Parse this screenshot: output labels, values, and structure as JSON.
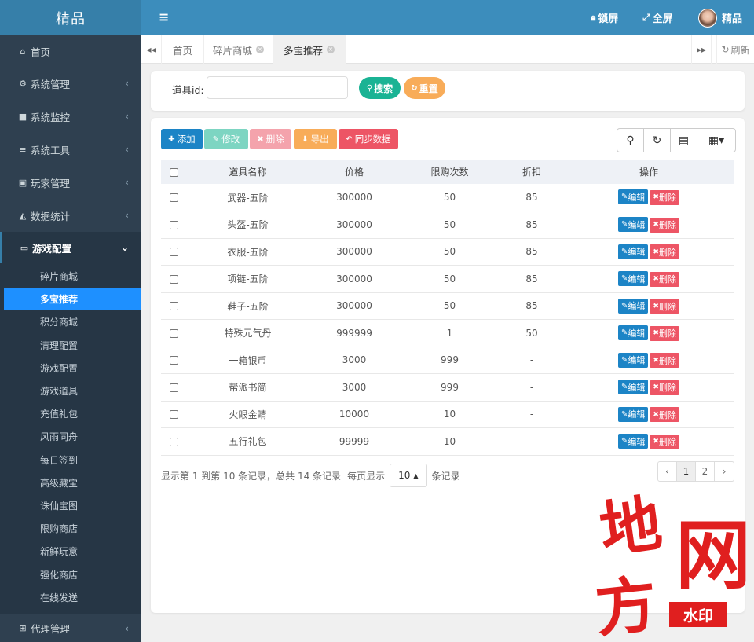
{
  "brand": "精品",
  "sidebar": {
    "items": [
      {
        "label": "首页",
        "icon": "home-icon"
      },
      {
        "label": "系统管理",
        "icon": "gear-icon"
      },
      {
        "label": "系统监控",
        "icon": "video-icon"
      },
      {
        "label": "系统工具",
        "icon": "bars-icon"
      },
      {
        "label": "玩家管理",
        "icon": "user-card-icon"
      },
      {
        "label": "数据统计",
        "icon": "area-chart-icon"
      },
      {
        "label": "游戏配置",
        "icon": "desktop-icon"
      }
    ],
    "submenu": [
      "碎片商城",
      "多宝推荐",
      "积分商城",
      "清理配置",
      "游戏配置",
      "游戏道具",
      "充值礼包",
      "风雨同舟",
      "每日签到",
      "高级藏宝",
      "诛仙宝图",
      "限购商店",
      "新鲜玩意",
      "强化商店",
      "在线发送"
    ],
    "active_sub": "多宝推荐",
    "bottom": {
      "label": "代理管理",
      "icon": "sitemap-icon"
    }
  },
  "topbar": {
    "lock": "锁屏",
    "fullscreen": "全屏",
    "user": "精品"
  },
  "tabs": {
    "items": [
      "首页",
      "碎片商城",
      "多宝推荐"
    ],
    "refresh": "刷新"
  },
  "search": {
    "label": "道具id:",
    "value": "",
    "search_btn": "搜索",
    "reset_btn": "重置"
  },
  "toolbar": {
    "add": "添加",
    "edit": "修改",
    "delete": "删除",
    "export": "导出",
    "sync": "同步数据"
  },
  "table": {
    "headers": [
      "道具名称",
      "价格",
      "限购次数",
      "折扣",
      "操作"
    ],
    "edit_label": "编辑",
    "delete_label": "删除",
    "rows": [
      {
        "name": "武器-五阶",
        "price": "300000",
        "limit": "50",
        "discount": "85"
      },
      {
        "name": "头盔-五阶",
        "price": "300000",
        "limit": "50",
        "discount": "85"
      },
      {
        "name": "衣服-五阶",
        "price": "300000",
        "limit": "50",
        "discount": "85"
      },
      {
        "name": "项链-五阶",
        "price": "300000",
        "limit": "50",
        "discount": "85"
      },
      {
        "name": "鞋子-五阶",
        "price": "300000",
        "limit": "50",
        "discount": "85"
      },
      {
        "name": "特殊元气丹",
        "price": "999999",
        "limit": "1",
        "discount": "50"
      },
      {
        "name": "一箱银币",
        "price": "3000",
        "limit": "999",
        "discount": "-"
      },
      {
        "name": "帮派书简",
        "price": "3000",
        "limit": "999",
        "discount": "-"
      },
      {
        "name": "火眼金睛",
        "price": "10000",
        "limit": "10",
        "discount": "-"
      },
      {
        "name": "五行礼包",
        "price": "99999",
        "limit": "10",
        "discount": "-"
      }
    ]
  },
  "footer": {
    "summary": "显示第 1 到第 10 条记录，总共 14 条记录",
    "per_page_prefix": "每页显示",
    "per_page": "10",
    "per_page_suffix": "条记录",
    "pages": [
      "‹",
      "1",
      "2",
      "›"
    ],
    "current_page": "1"
  },
  "watermark": {
    "big1": "地",
    "big2": "网",
    "big3": "方",
    "tag": "水印"
  },
  "colors": {
    "sidebar": "#2f4050",
    "topbar": "#3c8dbc",
    "active": "#1e90ff",
    "add": "#1c84c6",
    "edit": "#7dd5c2",
    "delete": "#f4a3ac",
    "export": "#f8ac59",
    "sync": "#ed5565",
    "search": "#1ab394",
    "reset": "#f8ac59"
  }
}
